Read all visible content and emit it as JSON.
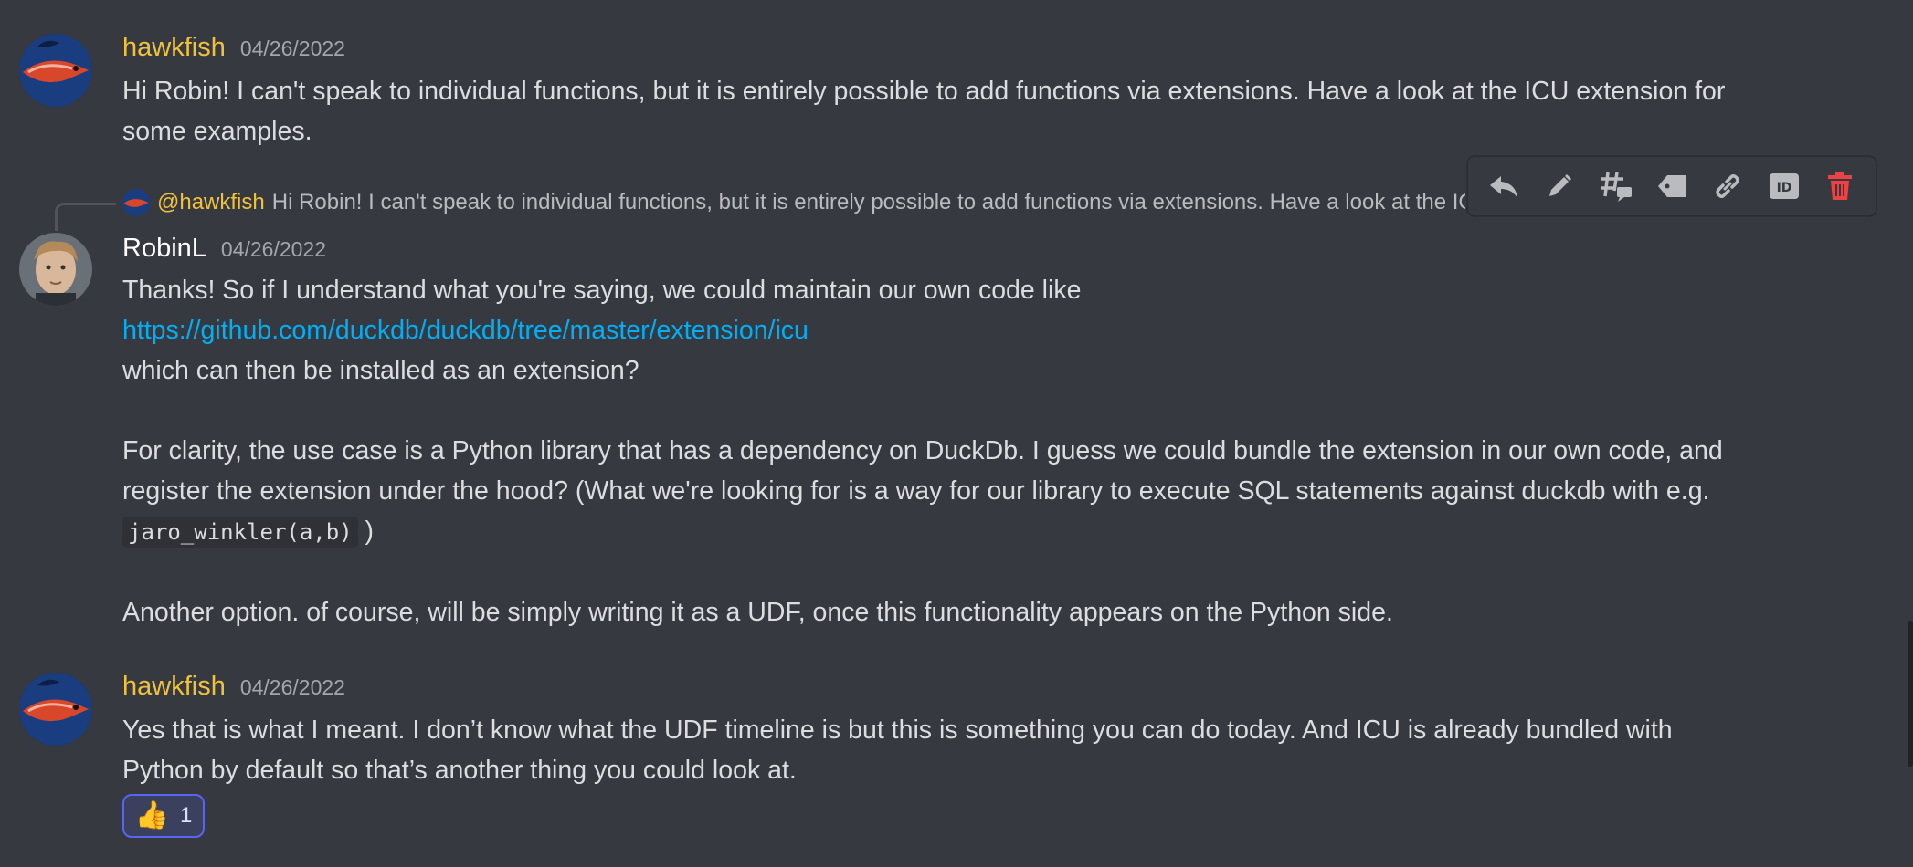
{
  "messages": [
    {
      "author": "hawkfish",
      "timestamp": "04/26/2022",
      "lines": [
        "Hi Robin!  I can't speak to individual functions, but it is entirely possible to add functions via extensions. Have a look at the ICU extension for",
        "some examples."
      ]
    },
    {
      "author": "RobinL",
      "timestamp": "04/26/2022",
      "reply_to": {
        "mention": "@hawkfish",
        "snippet": "Hi Robin!  I can't speak to individual functions, but it is entirely possible to add functions via extensions. Have a look at the ICU extension for some examples."
      },
      "line1": "Thanks!  So if I understand what you're saying, we could maintain our own code like",
      "link": "https://github.com/duckdb/duckdb/tree/master/extension/icu",
      "line3": "which can then be installed as an extension?",
      "para2_line1": "For clarity, the use case is a Python library that has a dependency on DuckDb.  I guess we could bundle the extension in our own code, and",
      "para2_line2": "register the extension under the hood?   (What we're looking for is a way for our library to execute SQL statements against duckdb with e.g.",
      "code": "jaro_winkler(a,b)",
      "code_after": " )",
      "para3": "Another option. of course, will be simply writing it as a UDF, once this functionality appears on the Python side."
    },
    {
      "author": "hawkfish",
      "timestamp": "04/26/2022",
      "lines": [
        "Yes that is what I meant. I don’t know what the UDF timeline is but this is something you can do today. And ICU is already bundled with",
        "Python by default so that’s another thing you could look at."
      ],
      "reaction": {
        "emoji": "👍",
        "count": "1"
      }
    }
  ],
  "toolbar": {
    "icons": [
      "reply-icon",
      "edit-icon",
      "thread-icon",
      "tag-icon",
      "link-icon",
      "id-icon",
      "delete-icon"
    ]
  },
  "colors": {
    "background": "#36393f",
    "hawkfish_name": "#f0c23c",
    "link": "#00aff4",
    "delete": "#ed4245",
    "reaction_border": "#5865f2"
  }
}
